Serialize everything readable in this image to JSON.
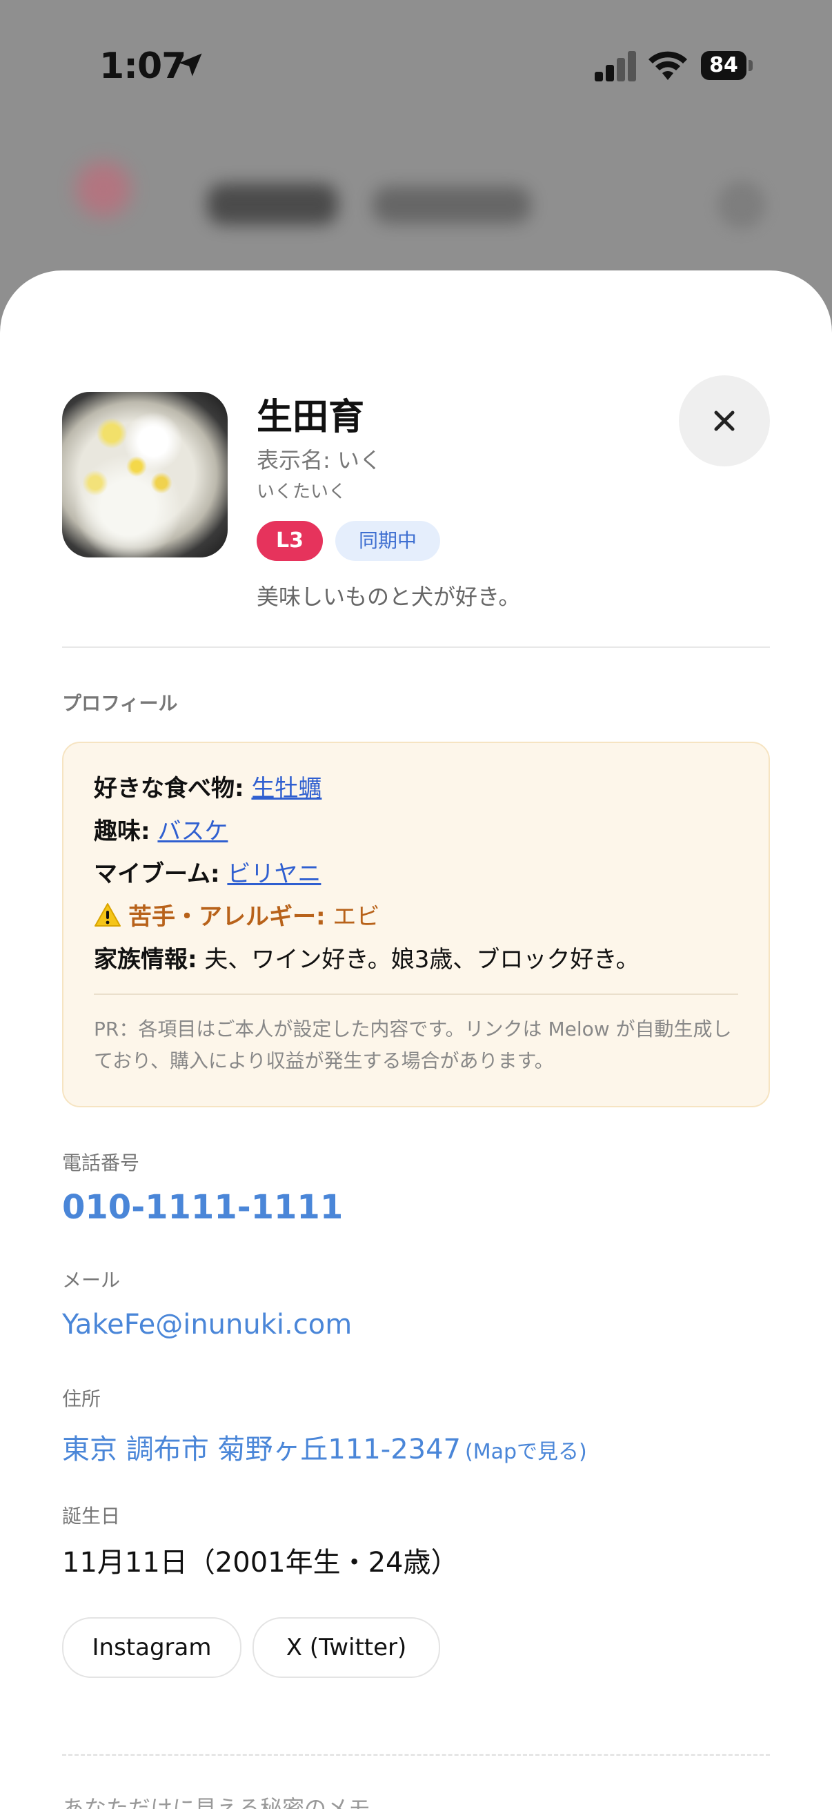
{
  "status_bar": {
    "time": "1:07",
    "battery": "84"
  },
  "profile": {
    "name": "生田育",
    "display_name": "表示名: いく",
    "kana": "いくたいく",
    "level_badge": "L3",
    "sync_badge": "同期中",
    "bio": "美味しいものと犬が好き。"
  },
  "section_title": "プロフィール",
  "card": {
    "rows": [
      {
        "label": "好きな食べ物:",
        "value": "生牡蠣"
      },
      {
        "label": "趣味:",
        "value": "バスケ"
      },
      {
        "label": "マイブーム:",
        "value": "ビリヤニ"
      },
      {
        "label": "苦手・アレルギー:",
        "value": "エビ"
      },
      {
        "label": "家族情報:",
        "value": "夫、ワイン好き。娘3歳、ブロック好き。"
      }
    ],
    "note": "PR：各項目はご本人が設定した内容です。リンクは Melow が自動生成しており、購入により収益が発生する場合があります。"
  },
  "fields": {
    "phone_label": "電話番号",
    "phone": "010-1111-1111",
    "email_label": "メール",
    "email": "YakeFe@inunuki.com",
    "address_label": "住所",
    "address": "東京 調布市 菊野ヶ丘111-2347",
    "map_link": "(Mapで見る)",
    "birthday_label": "誕生日",
    "birthday": "11月11日（2001年生・24歳）"
  },
  "social": {
    "instagram": "Instagram",
    "twitter": "X (Twitter)"
  },
  "secret_memo": "あなただけに見える秘密のメモ",
  "colors": {
    "accent": "#4a86d8",
    "badge_red": "#e6335c",
    "warn": "#b8621a",
    "card_bg": "#fdf6ea"
  }
}
